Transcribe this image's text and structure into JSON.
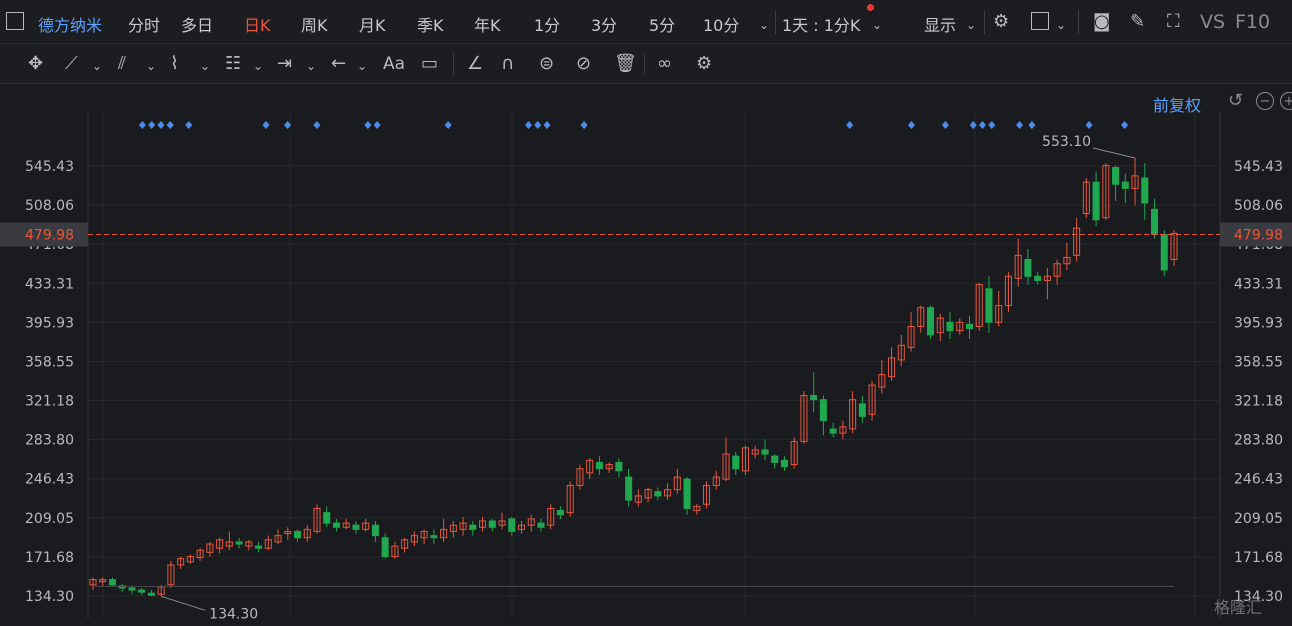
{
  "stock_name": "德方纳米",
  "periods": [
    "分时",
    "多日",
    "日K",
    "周K",
    "月K",
    "季K",
    "年K",
    "1分",
    "3分",
    "5分",
    "10分"
  ],
  "active_period": "日K",
  "period_select": "1天 : 1分K",
  "display_label": "显示",
  "vs_label": "VS",
  "f10_label": "F10",
  "adjust_label": "前复权",
  "watermark": "格隆汇",
  "icons": {
    "layout": "panel-layout-icon",
    "more": "chevron-down-icon",
    "settings": "gear-icon",
    "screenshot": "camera-icon",
    "draw": "pencil-icon",
    "fullscreen": "fullscreen-icon",
    "move": "move-cross-icon",
    "line": "trend-line-icon",
    "channel": "parallel-channel-icon",
    "polyline": "polyline-icon",
    "fib": "fibonacci-icon",
    "range": "range-measure-icon",
    "arrow": "arrow-left-icon",
    "text": "text-tool-icon",
    "note": "note-icon",
    "brush": "brush-icon",
    "magnet": "magnet-icon",
    "lock": "lock-icon",
    "hide": "hide-icon",
    "delete": "trash-icon",
    "compare": "compare-icon",
    "tool_settings": "gear-icon",
    "undo": "undo-icon",
    "zoom_out": "zoom-out-icon",
    "zoom_in": "zoom-in-icon"
  },
  "colors": {
    "up": "#e8553a",
    "down": "#1fa84f",
    "accent": "#5aa0ff",
    "price_line": "#e8553a",
    "marker": "#4a8df0"
  },
  "chart_data": {
    "type": "candlestick",
    "ylim": [
      134.3,
      553.1
    ],
    "yticks": [
      "545.43",
      "508.06",
      "471.68",
      "433.31",
      "395.93",
      "358.55",
      "321.18",
      "283.80",
      "246.43",
      "209.05",
      "171.68",
      "134.30"
    ],
    "high_label": "553.10",
    "low_label": "134.30",
    "last_price": "479.98",
    "candles": [
      [
        145,
        150,
        142,
        140,
        152
      ],
      [
        148,
        150,
        146,
        144,
        152
      ],
      [
        150,
        145,
        143,
        144,
        152
      ],
      [
        144,
        142,
        140,
        138,
        146
      ],
      [
        142,
        140,
        138,
        136,
        144
      ],
      [
        140,
        138,
        137,
        135,
        142
      ],
      [
        137,
        135,
        136,
        134.3,
        140
      ],
      [
        136,
        143,
        141,
        134,
        145
      ],
      [
        145,
        164,
        160,
        142,
        168
      ],
      [
        164,
        170,
        168,
        160,
        172
      ],
      [
        167,
        172,
        170,
        165,
        174
      ],
      [
        171,
        178,
        176,
        168,
        180
      ],
      [
        176,
        184,
        182,
        172,
        186
      ],
      [
        180,
        188,
        186,
        175,
        190
      ],
      [
        182,
        186,
        184,
        178,
        196
      ],
      [
        186,
        184,
        182,
        180,
        190
      ],
      [
        182,
        186,
        184,
        178,
        188
      ],
      [
        182,
        180,
        178,
        176,
        186
      ],
      [
        180,
        188,
        186,
        178,
        192
      ],
      [
        186,
        192,
        190,
        184,
        198
      ],
      [
        194,
        196,
        195,
        188,
        200
      ],
      [
        196,
        190,
        188,
        186,
        198
      ],
      [
        190,
        198,
        196,
        186,
        202
      ],
      [
        196,
        218,
        216,
        194,
        222
      ],
      [
        214,
        204,
        202,
        200,
        220
      ],
      [
        204,
        200,
        198,
        196,
        208
      ],
      [
        200,
        204,
        202,
        198,
        208
      ],
      [
        202,
        198,
        200,
        194,
        206
      ],
      [
        198,
        204,
        202,
        196,
        208
      ],
      [
        202,
        192,
        190,
        186,
        206
      ],
      [
        190,
        172,
        174,
        170,
        194
      ],
      [
        172,
        182,
        180,
        170,
        186
      ],
      [
        180,
        188,
        186,
        176,
        190
      ],
      [
        186,
        192,
        190,
        182,
        196
      ],
      [
        190,
        196,
        194,
        184,
        198
      ],
      [
        192,
        190,
        188,
        184,
        198
      ],
      [
        190,
        198,
        196,
        186,
        208
      ],
      [
        196,
        202,
        200,
        190,
        206
      ],
      [
        198,
        204,
        202,
        192,
        210
      ],
      [
        202,
        198,
        200,
        192,
        206
      ],
      [
        200,
        206,
        204,
        196,
        210
      ],
      [
        206,
        200,
        202,
        196,
        208
      ],
      [
        202,
        206,
        204,
        198,
        214
      ],
      [
        208,
        196,
        198,
        192,
        210
      ],
      [
        198,
        202,
        200,
        194,
        206
      ],
      [
        202,
        208,
        206,
        196,
        212
      ],
      [
        204,
        200,
        202,
        196,
        208
      ],
      [
        202,
        218,
        216,
        198,
        222
      ],
      [
        216,
        212,
        214,
        208,
        220
      ],
      [
        214,
        240,
        238,
        210,
        244
      ],
      [
        240,
        256,
        254,
        236,
        260
      ],
      [
        252,
        264,
        262,
        246,
        266
      ],
      [
        262,
        256,
        258,
        250,
        268
      ],
      [
        256,
        260,
        258,
        252,
        262
      ],
      [
        262,
        254,
        256,
        248,
        266
      ],
      [
        248,
        226,
        228,
        220,
        256
      ],
      [
        224,
        230,
        228,
        220,
        236
      ],
      [
        228,
        236,
        234,
        224,
        238
      ],
      [
        234,
        230,
        232,
        226,
        238
      ],
      [
        230,
        236,
        234,
        226,
        242
      ],
      [
        236,
        248,
        246,
        232,
        256
      ],
      [
        246,
        218,
        220,
        212,
        248
      ],
      [
        216,
        220,
        218,
        212,
        222
      ],
      [
        222,
        240,
        238,
        218,
        244
      ],
      [
        240,
        248,
        246,
        236,
        254
      ],
      [
        246,
        270,
        268,
        244,
        286
      ],
      [
        268,
        256,
        258,
        250,
        272
      ],
      [
        254,
        276,
        274,
        250,
        278
      ],
      [
        270,
        274,
        272,
        266,
        278
      ],
      [
        274,
        270,
        272,
        264,
        284
      ],
      [
        268,
        262,
        264,
        256,
        270
      ],
      [
        264,
        258,
        260,
        254,
        268
      ],
      [
        260,
        282,
        280,
        256,
        286
      ],
      [
        282,
        326,
        324,
        280,
        330
      ],
      [
        326,
        322,
        324,
        310,
        348
      ],
      [
        322,
        302,
        304,
        288,
        326
      ],
      [
        294,
        290,
        292,
        286,
        300
      ],
      [
        290,
        296,
        294,
        284,
        302
      ],
      [
        294,
        322,
        320,
        290,
        330
      ],
      [
        318,
        306,
        308,
        300,
        326
      ],
      [
        308,
        336,
        334,
        302,
        340
      ],
      [
        334,
        346,
        344,
        328,
        360
      ],
      [
        344,
        362,
        360,
        340,
        372
      ],
      [
        360,
        374,
        372,
        354,
        384
      ],
      [
        372,
        392,
        390,
        368,
        406
      ],
      [
        392,
        410,
        408,
        386,
        412
      ],
      [
        410,
        384,
        386,
        380,
        412
      ],
      [
        386,
        400,
        398,
        378,
        404
      ],
      [
        396,
        388,
        390,
        380,
        406
      ],
      [
        388,
        396,
        394,
        384,
        400
      ],
      [
        394,
        390,
        392,
        380,
        402
      ],
      [
        392,
        432,
        430,
        388,
        434
      ],
      [
        428,
        396,
        398,
        386,
        440
      ],
      [
        396,
        412,
        410,
        392,
        426
      ],
      [
        412,
        440,
        438,
        406,
        444
      ],
      [
        438,
        460,
        458,
        430,
        476
      ],
      [
        456,
        440,
        442,
        432,
        466
      ],
      [
        440,
        436,
        438,
        432,
        444
      ],
      [
        436,
        440,
        438,
        418,
        448
      ],
      [
        440,
        452,
        450,
        432,
        456
      ],
      [
        452,
        458,
        456,
        446,
        472
      ],
      [
        460,
        486,
        484,
        454,
        496
      ],
      [
        500,
        530,
        528,
        496,
        534
      ],
      [
        530,
        494,
        496,
        488,
        540
      ],
      [
        496,
        546,
        544,
        494,
        548
      ],
      [
        544,
        528,
        530,
        512,
        546
      ],
      [
        530,
        524,
        526,
        510,
        538
      ],
      [
        524,
        536,
        534,
        508,
        553.1
      ],
      [
        534,
        510,
        512,
        494,
        548
      ],
      [
        504,
        480,
        482,
        476,
        514
      ],
      [
        480,
        446,
        448,
        440,
        484
      ],
      [
        456,
        481,
        479.98,
        450,
        484
      ]
    ],
    "markers": [
      0.032,
      0.038,
      0.044,
      0.05,
      0.062,
      0.112,
      0.126,
      0.145,
      0.178,
      0.184,
      0.23,
      0.282,
      0.288,
      0.294,
      0.318,
      0.49,
      0.53,
      0.552,
      0.57,
      0.576,
      0.582,
      0.6,
      0.608,
      0.645,
      0.668
    ]
  }
}
